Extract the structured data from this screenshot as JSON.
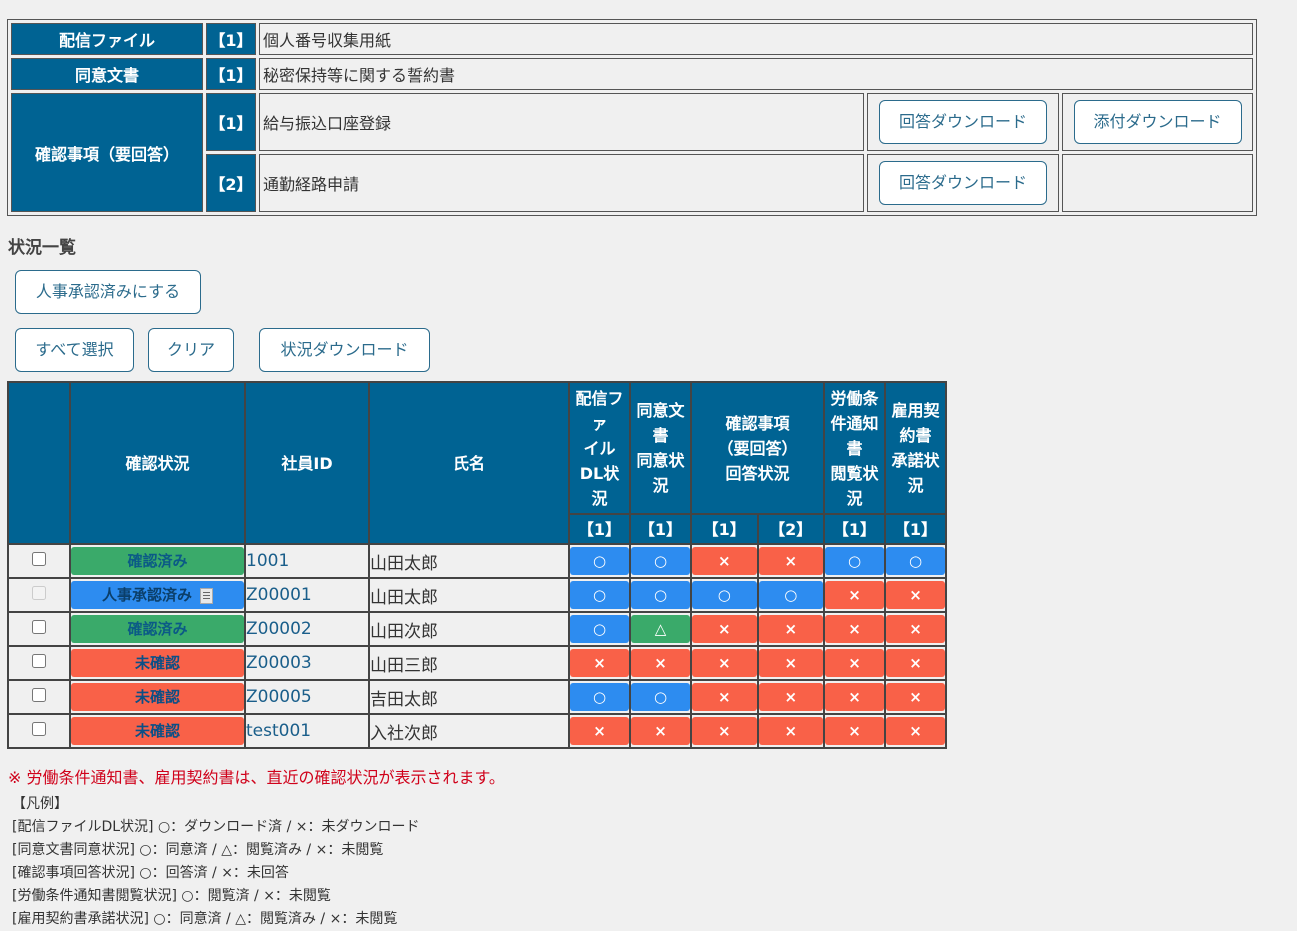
{
  "info": {
    "rows": [
      {
        "header": "配信ファイル",
        "num": "【1】",
        "value": "個人番号収集用紙"
      },
      {
        "header": "同意文書",
        "num": "【1】",
        "value": "秘密保持等に関する誓約書"
      }
    ],
    "confirm": {
      "header": "確認事項（要回答）",
      "items": [
        {
          "num": "【1】",
          "value": "給与振込口座登録",
          "answer_btn": "回答ダウンロード",
          "attach_btn": "添付ダウンロード"
        },
        {
          "num": "【2】",
          "value": "通勤経路申請",
          "answer_btn": "回答ダウンロード"
        }
      ]
    }
  },
  "section_title": "状況一覧",
  "buttons": {
    "approve": "人事承認済みにする",
    "select_all": "すべて選択",
    "clear": "クリア",
    "status_download": "状況ダウンロード"
  },
  "table": {
    "headers": {
      "status": "確認状況",
      "emp_id": "社員ID",
      "name": "氏名",
      "dl_status": "配信ファ\nイル\nDL状\n況",
      "consent_status": "同意文\n書\n同意状\n況",
      "confirm_status": "確認事項\n（要回答）\n回答状況",
      "labor_status": "労働条\n件通知\n書\n閲覧状\n況",
      "contract_status": "雇用契\n約書\n承諾状\n況"
    },
    "subheaders": [
      "【1】",
      "【1】",
      "【1】",
      "【2】",
      "【1】",
      "【1】"
    ],
    "rows": [
      {
        "status": "確認済み",
        "status_color": "green",
        "doc_icon": false,
        "checkbox_disabled": false,
        "id": "1001",
        "name": "山田太郎",
        "marks": [
          "○",
          "○",
          "×",
          "×",
          "○",
          "○"
        ]
      },
      {
        "status": "人事承認済み",
        "status_color": "blue",
        "doc_icon": true,
        "checkbox_disabled": true,
        "id": "Z00001",
        "name": "山田太郎",
        "marks": [
          "○",
          "○",
          "○",
          "○",
          "×",
          "×"
        ]
      },
      {
        "status": "確認済み",
        "status_color": "green",
        "doc_icon": false,
        "checkbox_disabled": false,
        "id": "Z00002",
        "name": "山田次郎",
        "marks": [
          "○",
          "△",
          "×",
          "×",
          "×",
          "×"
        ]
      },
      {
        "status": "未確認",
        "status_color": "red",
        "doc_icon": false,
        "checkbox_disabled": false,
        "id": "Z00003",
        "name": "山田三郎",
        "marks": [
          "×",
          "×",
          "×",
          "×",
          "×",
          "×"
        ]
      },
      {
        "status": "未確認",
        "status_color": "red",
        "doc_icon": false,
        "checkbox_disabled": false,
        "id": "Z00005",
        "name": "吉田太郎",
        "marks": [
          "○",
          "○",
          "×",
          "×",
          "×",
          "×"
        ]
      },
      {
        "status": "未確認",
        "status_color": "red",
        "doc_icon": false,
        "checkbox_disabled": false,
        "id": "test001",
        "name": "入社次郎",
        "marks": [
          "×",
          "×",
          "×",
          "×",
          "×",
          "×"
        ]
      }
    ]
  },
  "note": "※ 労働条件通知書、雇用契約書は、直近の確認状況が表示されます。",
  "legend": {
    "title": "【凡例】",
    "lines": [
      "[配信ファイルDL状況]  ○：ダウンロード済 / ×：未ダウンロード",
      "[同意文書同意状況]  ○：同意済 / △：閲覧済み / ×：未閲覧",
      "[確認事項回答状況]  ○：回答済 / ×：未回答",
      "[労働条件通知書閲覧状況]  ○：閲覧済 / ×：未閲覧",
      "[雇用契約書承諾状況]  ○：同意済 / △：閲覧済み / ×：未閲覧"
    ]
  },
  "colors": {
    "header_bg": "#006393",
    "green": "#3aaa6a",
    "blue": "#2d8cf0",
    "red": "#f96148",
    "note": "#d0021b"
  }
}
